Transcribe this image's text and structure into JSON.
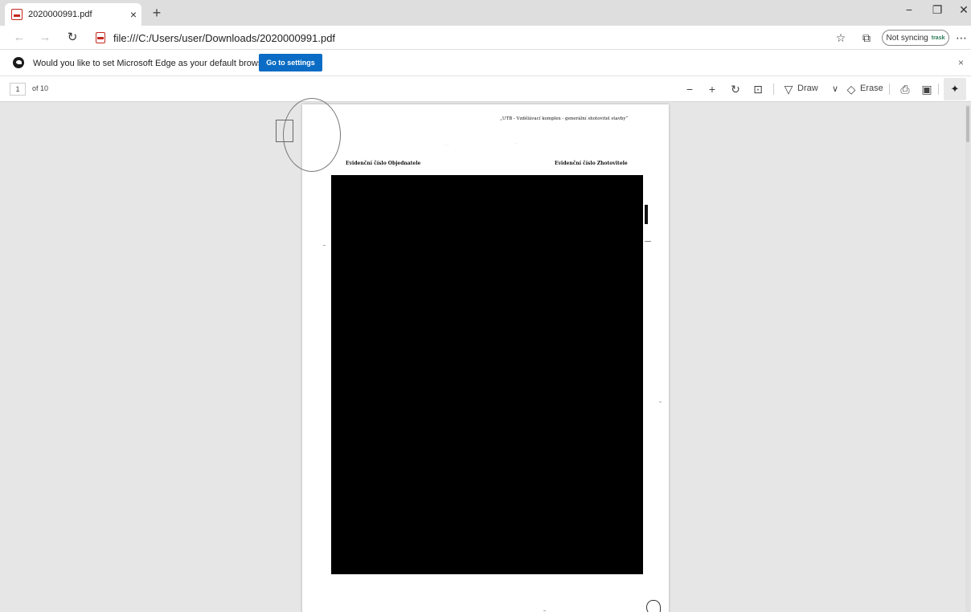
{
  "tab": {
    "title": "2020000991.pdf",
    "close_icon": "×",
    "new_tab_icon": "+"
  },
  "window_controls": {
    "minimize": "−",
    "restore": "❐",
    "close": "✕"
  },
  "address": {
    "url": "file:///C:/Users/user/Downloads/2020000991.pdf"
  },
  "profile": {
    "label": "Not syncing",
    "badge": "trask"
  },
  "infobar": {
    "message": "Would you like to set Microsoft Edge as your default browser?",
    "button": "Go to settings",
    "close": "×"
  },
  "pdf_toolbar": {
    "page_number": "1",
    "page_of": "of 10",
    "draw_label": "Draw",
    "erase_label": "Erase"
  },
  "document": {
    "header": "„UTB - Vzdělávací komplex - generální shotovitel stavby“",
    "evid_left": "Evidenční číslo Objednatele",
    "evid_right": "Evidenční číslo Zhotovitele"
  },
  "colors": {
    "accent_button": "#0a6cc4",
    "pdf_icon": "#c4271e",
    "redaction": "#000000"
  }
}
